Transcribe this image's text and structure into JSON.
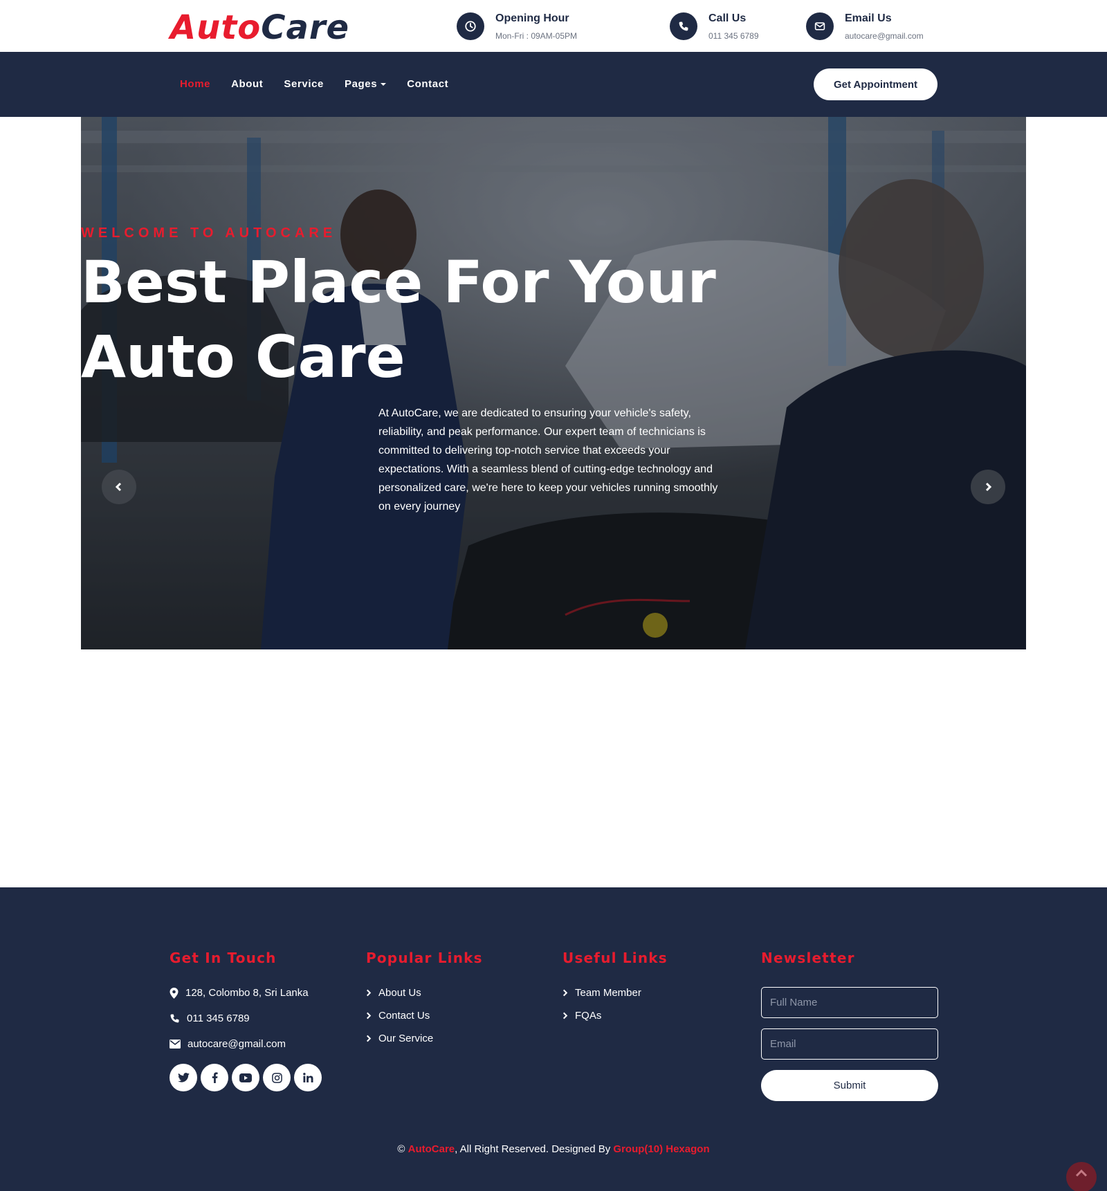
{
  "brand": {
    "part1": "Auto",
    "part2": "Care"
  },
  "topbar": {
    "opening": {
      "title": "Opening Hour",
      "value": "Mon-Fri : 09AM-05PM",
      "icon": "clock-icon"
    },
    "call": {
      "title": "Call Us",
      "value": "011 345 6789",
      "icon": "phone-icon"
    },
    "email": {
      "title": "Email Us",
      "value": "autocare@gmail.com",
      "icon": "envelope-icon"
    }
  },
  "nav": {
    "items": [
      {
        "label": "Home",
        "active": true
      },
      {
        "label": "About",
        "active": false
      },
      {
        "label": "Service",
        "active": false
      },
      {
        "label": "Pages",
        "active": false,
        "dropdown": true
      },
      {
        "label": "Contact",
        "active": false
      }
    ],
    "cta": "Get Appointment"
  },
  "hero": {
    "eyebrow": "WELCOME TO AUTOCARE",
    "title_line1": "Best Place For Your",
    "title_line2": "Auto Care",
    "description": "At AutoCare, we are dedicated to ensuring your vehicle's safety, reliability, and peak performance. Our expert team of technicians is committed to delivering top-notch service that exceeds your expectations. With a seamless blend of cutting-edge technology and personalized care, we're here to keep your vehicles running smoothly on every journey"
  },
  "footer": {
    "get_in_touch": {
      "heading": "Get In Touch",
      "address": "128, Colombo 8, Sri Lanka",
      "phone": "011 345 6789",
      "email": "autocare@gmail.com",
      "socials": [
        "twitter-icon",
        "facebook-icon",
        "youtube-icon",
        "instagram-icon",
        "linkedin-icon"
      ]
    },
    "popular_links": {
      "heading": "Popular Links",
      "items": [
        "About Us",
        "Contact Us",
        "Our Service"
      ]
    },
    "useful_links": {
      "heading": "Useful Links",
      "items": [
        "Team Member",
        "FQAs"
      ]
    },
    "newsletter": {
      "heading": "Newsletter",
      "name_placeholder": "Full Name",
      "email_placeholder": "Email",
      "submit": "Submit"
    },
    "copyright": {
      "prefix": "© ",
      "brand": "AutoCare",
      "middle": ", All Right Reserved. Designed By ",
      "designer": "Group(10) Hexagon"
    }
  },
  "colors": {
    "brand_red": "#e81c2e",
    "navy": "#1f2a44",
    "white": "#ffffff"
  }
}
